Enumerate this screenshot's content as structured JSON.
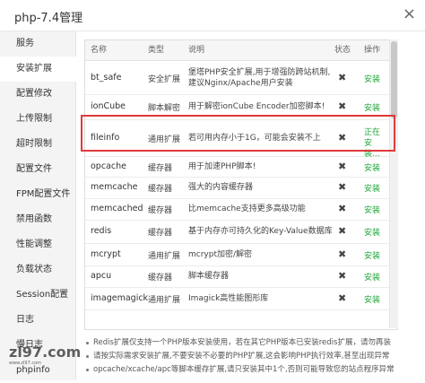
{
  "window": {
    "title": "php-7.4管理",
    "close_glyph": "×"
  },
  "sidebar": {
    "items": [
      {
        "label": "服务",
        "active": false
      },
      {
        "label": "安装扩展",
        "active": true
      },
      {
        "label": "配置修改",
        "active": false
      },
      {
        "label": "上传限制",
        "active": false
      },
      {
        "label": "超时限制",
        "active": false
      },
      {
        "label": "配置文件",
        "active": false
      },
      {
        "label": "FPM配置文件",
        "active": false
      },
      {
        "label": "禁用函数",
        "active": false
      },
      {
        "label": "性能调整",
        "active": false
      },
      {
        "label": "负载状态",
        "active": false
      },
      {
        "label": "Session配置",
        "active": false
      },
      {
        "label": "日志",
        "active": false
      },
      {
        "label": "慢日志",
        "active": false
      },
      {
        "label": "phpinfo",
        "active": false
      }
    ]
  },
  "table": {
    "headers": {
      "name": "名称",
      "type": "类型",
      "desc": "说明",
      "status": "状态",
      "op": "操作"
    },
    "rows": [
      {
        "name": "bt_safe",
        "type": "安全扩展",
        "desc": "堡塔PHP安全扩展,用于增强防跨站机制,建议Nginx/Apache用户安装",
        "status": "✖",
        "op": "安装"
      },
      {
        "name": "ionCube",
        "type": "脚本解密",
        "desc": "用于解密ionCube Encoder加密脚本!",
        "status": "✖",
        "op": "安装"
      },
      {
        "name": "fileinfo",
        "type": "通用扩展",
        "desc": "若可用内存小于1G，可能会安装不上",
        "status": "✖",
        "op": "正在安装..."
      },
      {
        "name": "opcache",
        "type": "缓存器",
        "desc": "用于加速PHP脚本!",
        "status": "✖",
        "op": "安装"
      },
      {
        "name": "memcache",
        "type": "缓存器",
        "desc": "强大的内容缓存器",
        "status": "✖",
        "op": "安装"
      },
      {
        "name": "memcached",
        "type": "缓存器",
        "desc": "比memcache支持更多高级功能",
        "status": "✖",
        "op": "安装"
      },
      {
        "name": "redis",
        "type": "缓存器",
        "desc": "基于内存亦可持久化的Key-Value数据库",
        "status": "✖",
        "op": "安装"
      },
      {
        "name": "mcrypt",
        "type": "通用扩展",
        "desc": "mcrypt加密/解密",
        "status": "✖",
        "op": "安装"
      },
      {
        "name": "apcu",
        "type": "缓存器",
        "desc": "脚本缓存器",
        "status": "✖",
        "op": "安装"
      },
      {
        "name": "imagemagick",
        "type": "通用扩展",
        "desc": "Imagick高性能图形库",
        "status": "✖",
        "op": "安装"
      }
    ]
  },
  "notes": [
    "Redis扩展仅支持一个PHP版本安装使用，若在其它PHP版本已安装redis扩展，请勿再装",
    "请按实际需求安装扩展,不要安装不必要的PHP扩展,这会影响PHP执行效率,甚至出现异常",
    "opcache/xcache/apc等脚本缓存扩展,请只安装其中1个,否则可能导致您的站点程序异常"
  ],
  "watermark": {
    "text": "zl97.com",
    "sub": "www.zl97.com"
  },
  "colors": {
    "accent_green": "#20a53a",
    "highlight_red": "#e03a3a"
  }
}
